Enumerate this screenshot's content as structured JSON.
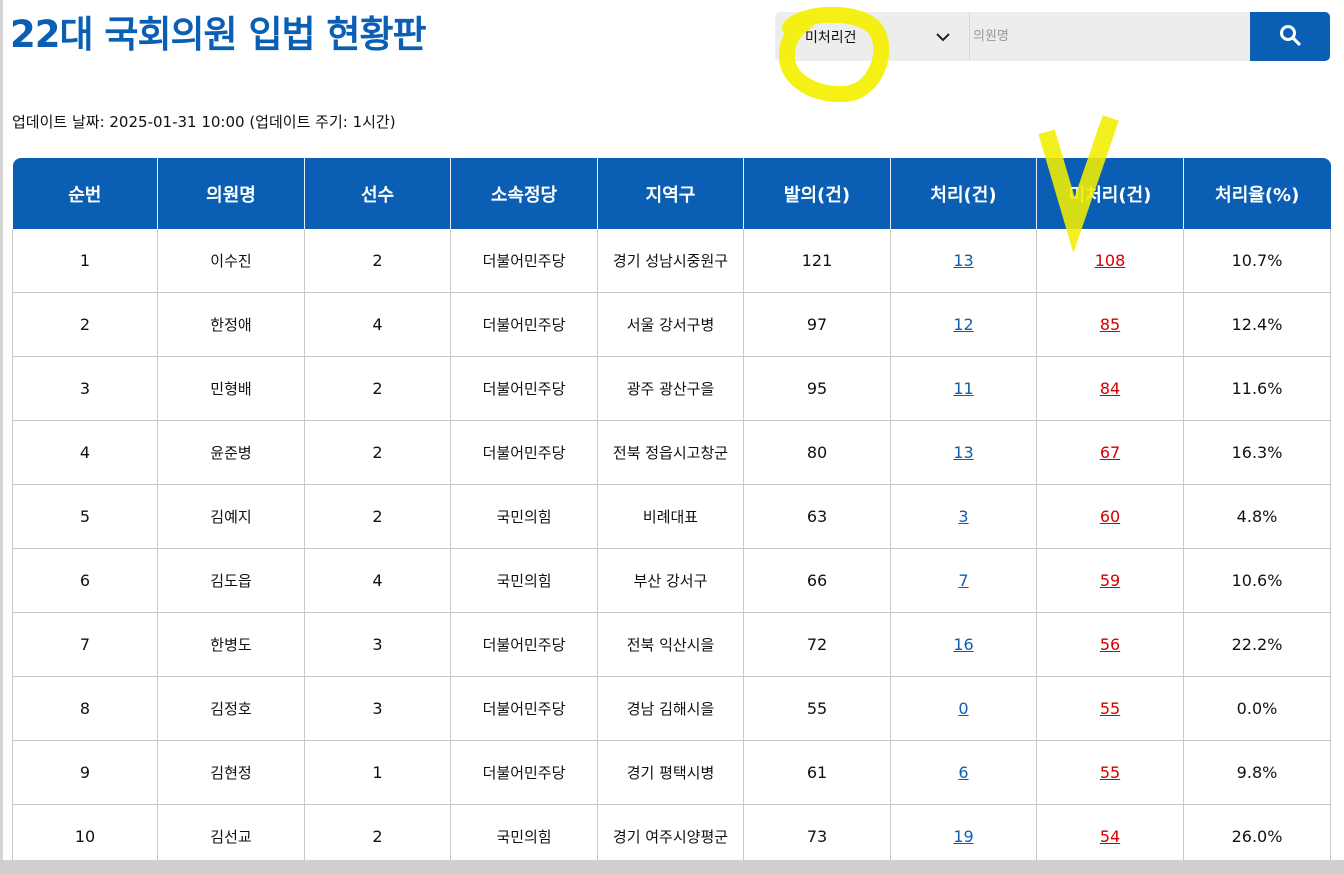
{
  "page": {
    "title": "22대 국회의원 입법 현황판",
    "update_text": "업데이트 날짜: 2025-01-31 10:00 (업데이트 주기: 1시간)"
  },
  "search": {
    "filter_value": "미처리건",
    "placeholder": "의원명",
    "search_icon": "search-icon",
    "chevron_icon": "chevron-down-icon"
  },
  "annotations": {
    "circle_color": "#f5f000",
    "check_mark": "V"
  },
  "colors": {
    "brand_blue": "#0a5fb4",
    "processed_link": "#0a5fb4",
    "unprocessed_link": "#d40000"
  },
  "table": {
    "headers": [
      "순번",
      "의원명",
      "선수",
      "소속정당",
      "지역구",
      "발의(건)",
      "처리(건)",
      "미처리(건)",
      "처리율(%)"
    ],
    "rows": [
      {
        "no": "1",
        "name": "이수진",
        "terms": "2",
        "party": "더불어민주당",
        "region": "경기 성남시중원구",
        "proposed": "121",
        "processed": "13",
        "unprocessed": "108",
        "rate": "10.7%"
      },
      {
        "no": "2",
        "name": "한정애",
        "terms": "4",
        "party": "더불어민주당",
        "region": "서울 강서구병",
        "proposed": "97",
        "processed": "12",
        "unprocessed": "85",
        "rate": "12.4%"
      },
      {
        "no": "3",
        "name": "민형배",
        "terms": "2",
        "party": "더불어민주당",
        "region": "광주 광산구을",
        "proposed": "95",
        "processed": "11",
        "unprocessed": "84",
        "rate": "11.6%"
      },
      {
        "no": "4",
        "name": "윤준병",
        "terms": "2",
        "party": "더불어민주당",
        "region": "전북 정읍시고창군",
        "proposed": "80",
        "processed": "13",
        "unprocessed": "67",
        "rate": "16.3%"
      },
      {
        "no": "5",
        "name": "김예지",
        "terms": "2",
        "party": "국민의힘",
        "region": "비례대표",
        "proposed": "63",
        "processed": "3",
        "unprocessed": "60",
        "rate": "4.8%"
      },
      {
        "no": "6",
        "name": "김도읍",
        "terms": "4",
        "party": "국민의힘",
        "region": "부산 강서구",
        "proposed": "66",
        "processed": "7",
        "unprocessed": "59",
        "rate": "10.6%"
      },
      {
        "no": "7",
        "name": "한병도",
        "terms": "3",
        "party": "더불어민주당",
        "region": "전북 익산시을",
        "proposed": "72",
        "processed": "16",
        "unprocessed": "56",
        "rate": "22.2%"
      },
      {
        "no": "8",
        "name": "김정호",
        "terms": "3",
        "party": "더불어민주당",
        "region": "경남 김해시을",
        "proposed": "55",
        "processed": "0",
        "unprocessed": "55",
        "rate": "0.0%"
      },
      {
        "no": "9",
        "name": "김현정",
        "terms": "1",
        "party": "더불어민주당",
        "region": "경기 평택시병",
        "proposed": "61",
        "processed": "6",
        "unprocessed": "55",
        "rate": "9.8%"
      },
      {
        "no": "10",
        "name": "김선교",
        "terms": "2",
        "party": "국민의힘",
        "region": "경기 여주시양평군",
        "proposed": "73",
        "processed": "19",
        "unprocessed": "54",
        "rate": "26.0%"
      }
    ]
  }
}
